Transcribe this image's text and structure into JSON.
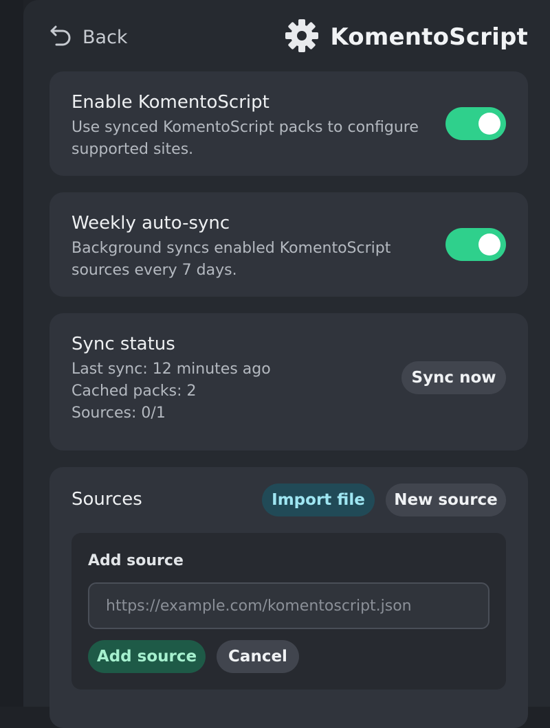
{
  "header": {
    "back_label": "Back",
    "title": "KomentoScript"
  },
  "enable_card": {
    "title": "Enable KomentoScript",
    "desc_line1": "Use synced KomentoScript packs to configure",
    "desc_line2": "supported sites.",
    "toggle_on": true
  },
  "autosync_card": {
    "title": "Weekly auto-sync",
    "desc_line1": "Background syncs enabled KomentoScript",
    "desc_line2": "sources every 7 days.",
    "toggle_on": true
  },
  "status_card": {
    "title": "Sync status",
    "last_sync": "Last sync: 12 minutes ago",
    "cached_packs": "Cached packs: 2",
    "sources": "Sources: 0/1",
    "sync_now_label": "Sync now"
  },
  "sources_card": {
    "title": "Sources",
    "import_label": "Import file",
    "new_source_label": "New source",
    "add_source": {
      "heading": "Add source",
      "input_value": "",
      "input_placeholder": "https://example.com/komentoscript.json",
      "submit_label": "Add source",
      "cancel_label": "Cancel"
    }
  },
  "colors": {
    "toggle_on": "#2fd08c",
    "panel_bg": "#262a30",
    "card_bg": "#30343c",
    "import_button_bg": "#214a57",
    "add_button_bg": "#1e5a47"
  },
  "icons": {
    "back": "undo-arrow-icon",
    "title": "gear-icon"
  }
}
